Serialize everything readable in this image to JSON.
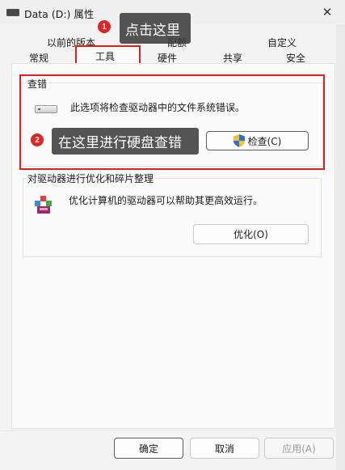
{
  "window": {
    "title": "Data (D:) 属性",
    "close_glyph": "✕"
  },
  "tabs": {
    "row1": [
      "以前的版本",
      "配额",
      "自定义"
    ],
    "row2": [
      "常规",
      "工具",
      "硬件",
      "共享",
      "安全"
    ],
    "active": "工具"
  },
  "error_check": {
    "title": "查错",
    "description": "此选项将检查驱动器中的文件系统错误。",
    "button_label": "检查(C)",
    "icon": "drive-icon"
  },
  "optimize": {
    "title": "对驱动器进行优化和碎片整理",
    "description": "优化计算机的驱动器可以帮助其更高效运行。",
    "button_label": "优化(O)",
    "icon": "defrag-icon"
  },
  "footer": {
    "ok_label": "确定",
    "cancel_label": "取消",
    "apply_label": "应用(A)"
  },
  "annotations": [
    {
      "badge": "1",
      "text": "点击这里"
    },
    {
      "badge": "2",
      "text": "在这里进行硬盘查错"
    }
  ],
  "colors": {
    "highlight_red": "#e01f1f",
    "callout_bg": "#3c3c3c",
    "badge_red": "#e02424"
  }
}
